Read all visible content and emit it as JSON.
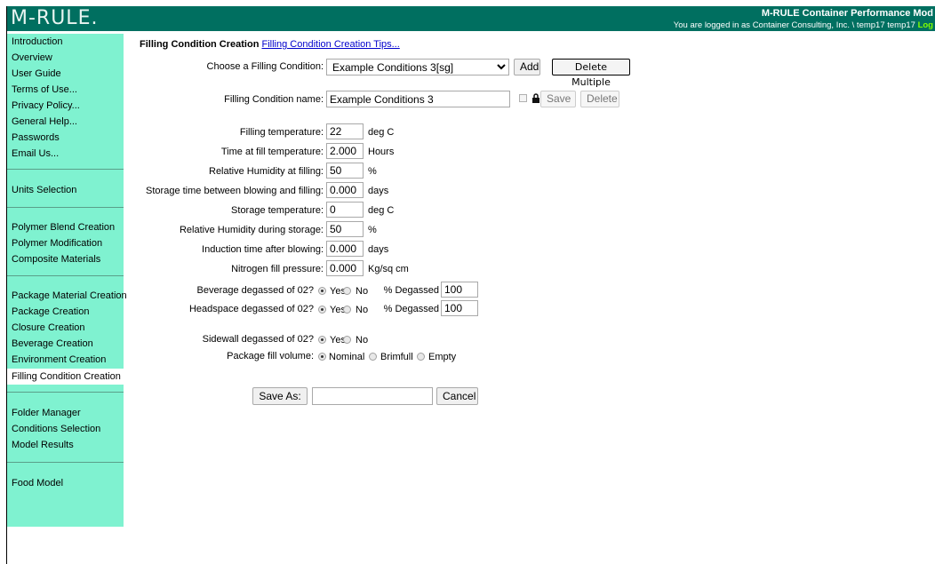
{
  "header": {
    "logo": "M-RULE.",
    "title": "M-RULE Container Performance Mod",
    "login_text": "You are logged in as Container Consulting, Inc. \\ temp17 temp17",
    "logout": "Log"
  },
  "sidebar": {
    "items": [
      {
        "label": "Introduction"
      },
      {
        "label": "Overview"
      },
      {
        "label": "User Guide"
      },
      {
        "label": "Terms of Use..."
      },
      {
        "label": "Privacy Policy..."
      },
      {
        "label": "General Help..."
      },
      {
        "label": "Passwords"
      },
      {
        "label": "Email Us..."
      },
      {
        "label": "Units Selection"
      },
      {
        "label": "Polymer Blend Creation"
      },
      {
        "label": "Polymer Modification"
      },
      {
        "label": "Composite Materials"
      },
      {
        "label": "Package Material Creation"
      },
      {
        "label": "Package Creation"
      },
      {
        "label": "Closure Creation"
      },
      {
        "label": "Beverage Creation"
      },
      {
        "label": "Environment Creation"
      },
      {
        "label": "Filling Condition Creation"
      },
      {
        "label": "Folder Manager"
      },
      {
        "label": "Conditions Selection"
      },
      {
        "label": "Model Results"
      },
      {
        "label": "Food Model"
      }
    ],
    "active": "Filling Condition Creation"
  },
  "page": {
    "title": "Filling Condition Creation",
    "tips_link": "Filling Condition Creation Tips..."
  },
  "choose": {
    "label": "Choose a Filling Condition:",
    "selected": "Example Conditions 3[sg]",
    "add": "Add",
    "delete_multiple": "Delete Multiple"
  },
  "name": {
    "label": "Filling Condition name:",
    "value": "Example Conditions 3",
    "save": "Save",
    "delete": "Delete"
  },
  "fields": [
    {
      "label": "Filling temperature:",
      "value": "22",
      "unit": "deg C"
    },
    {
      "label": "Time at fill temperature:",
      "value": "2.000",
      "unit": "Hours"
    },
    {
      "label": "Relative Humidity at filling:",
      "value": "50",
      "unit": "%"
    },
    {
      "label": "Storage time between blowing and filling:",
      "value": "0.000",
      "unit": "days"
    },
    {
      "label": "Storage temperature:",
      "value": "0",
      "unit": "deg C"
    },
    {
      "label": "Relative Humidity during storage:",
      "value": "50",
      "unit": "%"
    },
    {
      "label": "Induction time after blowing:",
      "value": "0.000",
      "unit": "days"
    },
    {
      "label": "Nitrogen fill pressure:",
      "value": "0.000",
      "unit": "Kg/sq cm"
    }
  ],
  "degassed": [
    {
      "label": "Beverage degassed of 02?",
      "yes": "Yes",
      "no": "No",
      "pct_label": "% Degassed",
      "pct_value": "100"
    },
    {
      "label": "Headspace degassed of 02?",
      "yes": "Yes",
      "no": "No",
      "pct_label": "% Degassed",
      "pct_value": "100"
    }
  ],
  "sidewall": {
    "label": "Sidewall degassed of 02?",
    "yes": "Yes",
    "no": "No"
  },
  "fill_volume": {
    "label": "Package fill volume:",
    "nominal": "Nominal",
    "brimfull": "Brimfull",
    "empty": "Empty"
  },
  "save_as": {
    "button": "Save As:",
    "value": "",
    "cancel": "Cancel"
  },
  "colors": {
    "header": "#006f60",
    "sidebar": "#7ff2d0",
    "link": "#0000cc"
  }
}
